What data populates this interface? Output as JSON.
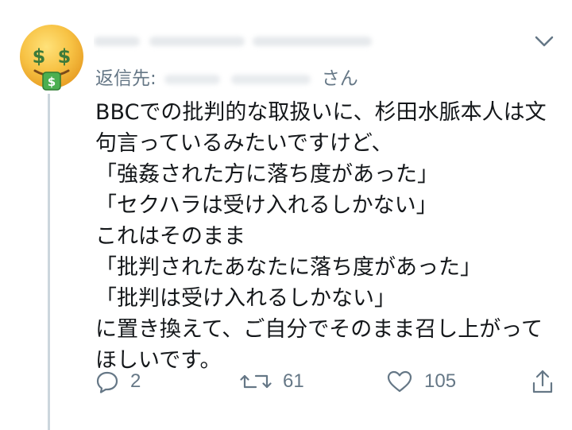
{
  "reply_to": {
    "prefix": "返信先:",
    "suffix": "さん"
  },
  "tweet": {
    "lines": [
      "BBCでの批判的な取扱いに、杉田水脈本人は文",
      "句言っているみたいですけど、",
      "「強姦された方に落ち度があった」",
      "「セクハラは受け入れるしかない」",
      "これはそのまま",
      "「批判されたあなたに落ち度があった」",
      "「批判は受け入れるしかない」",
      "に置き換えて、ご自分でそのまま召し上がって",
      "ほしいです。"
    ]
  },
  "actions": {
    "reply": {
      "icon": "reply-icon",
      "count": "2"
    },
    "retweet": {
      "icon": "retweet-icon",
      "count": "61"
    },
    "like": {
      "icon": "heart-icon",
      "count": "105"
    },
    "share": {
      "icon": "share-icon"
    }
  },
  "avatar": {
    "icon": "money-mouth-face-emoji"
  },
  "colors": {
    "text": "#14171a",
    "muted": "#657786",
    "thread_line": "#ccd6dd",
    "emoji_face": "#f5b83d",
    "emoji_money": "#3d9b4a"
  }
}
